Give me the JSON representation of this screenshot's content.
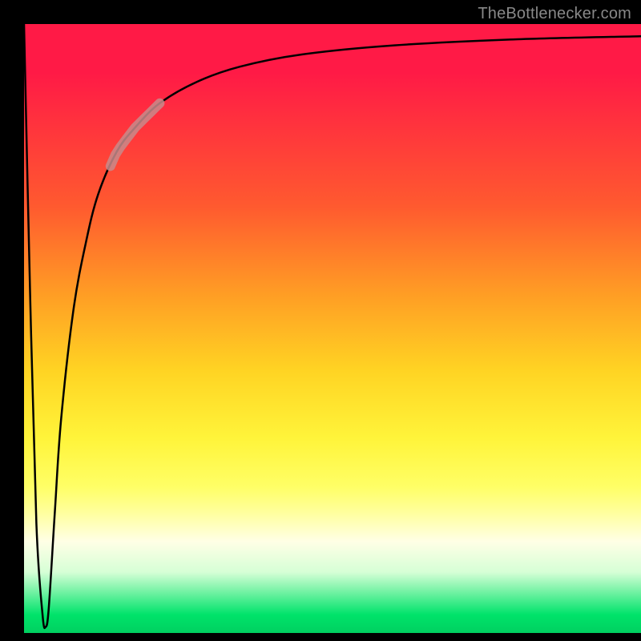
{
  "attribution": "TheBottlenecker.com",
  "colors": {
    "frame": "#000000",
    "curve": "#000000",
    "highlight": "#c88b8b",
    "gradient_top": "#ff1a46",
    "gradient_bottom": "#00d060"
  },
  "chart_data": {
    "type": "line",
    "title": "",
    "xlabel": "",
    "ylabel": "",
    "xlim": [
      0,
      100
    ],
    "ylim": [
      0,
      100
    ],
    "grid": false,
    "legend": null,
    "series": [
      {
        "name": "curve",
        "x": [
          0,
          1,
          2,
          3,
          3.5,
          4,
          5,
          6,
          8,
          10,
          12,
          15,
          18,
          22,
          28,
          35,
          45,
          60,
          80,
          100
        ],
        "y": [
          100,
          55,
          18,
          3,
          1,
          4,
          20,
          35,
          53,
          64,
          72,
          79,
          83,
          87,
          90.5,
          93,
          95,
          96.5,
          97.5,
          98
        ]
      }
    ],
    "highlight_segment": {
      "x_start": 14,
      "x_end": 22
    },
    "background_gradient": {
      "direction": "vertical",
      "stops": [
        {
          "pos": 0,
          "color": "#ff1a46"
        },
        {
          "pos": 30,
          "color": "#ff5a2f"
        },
        {
          "pos": 57,
          "color": "#ffd423"
        },
        {
          "pos": 76,
          "color": "#ffff66"
        },
        {
          "pos": 90,
          "color": "#d6ffd6"
        },
        {
          "pos": 100,
          "color": "#00d060"
        }
      ]
    }
  }
}
